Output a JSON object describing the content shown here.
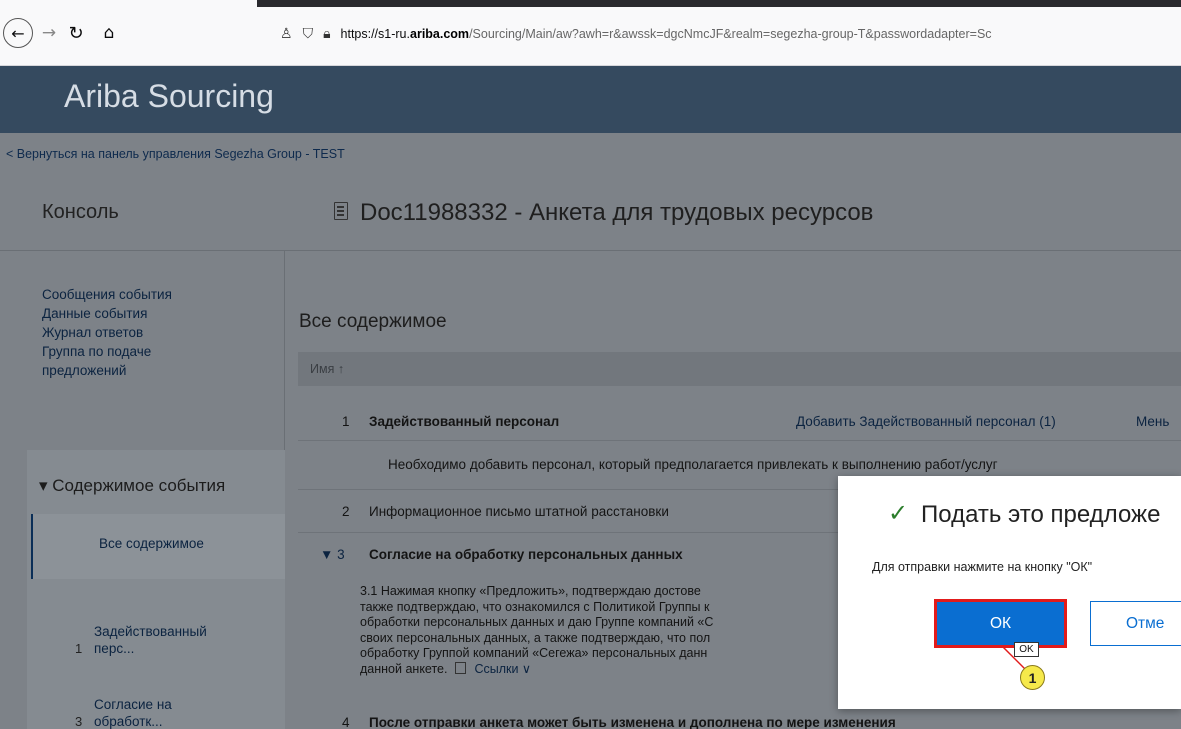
{
  "browser": {
    "url_prefix": "https://s1-ru.",
    "url_domain": "ariba.com",
    "url_rest": "/Sourcing/Main/aw?awh=r&awssk=dgcNmcJF&realm=segezha-group-T&passwordadapter=Sc",
    "back_icon": "back-arrow-icon",
    "forward_icon": "forward-arrow-icon",
    "reload_icon": "reload-icon",
    "home_icon": "home-icon"
  },
  "app": {
    "title": "Ariba Sourcing"
  },
  "back_link": "< Вернуться на панель управления Segezha Group - TEST",
  "left_title": "Консоль",
  "doc_title": "Doc11988332 - Анкета для трудовых ресурсов",
  "sidebar": {
    "links": [
      "Сообщения события",
      "Данные события",
      "Журнал ответов",
      "Группа по подаче",
      "предложений"
    ],
    "group_head": "▾ Содержимое события",
    "selected": "Все содержимое",
    "items": [
      {
        "num": "1",
        "line1": "Задействованный",
        "line2": "перс..."
      },
      {
        "num": "3",
        "line1": "Согласие на",
        "line2": "обработк..."
      }
    ]
  },
  "main": {
    "section_title": "Все содержимое",
    "column_header": "Имя ↑",
    "rows": {
      "r1_num": "1",
      "r1_title": "Задействованный персонал",
      "r1_link": "Добавить Задействованный персонал (1)",
      "r1_link2": "Мень",
      "r1_desc": "Необходимо добавить персонал, который предполагается привлекать к выполнению работ/услуг",
      "r2_num": "2",
      "r2_title": "Информационное письмо штатной расстановки",
      "r3_num": "▼ 3",
      "r3_title": "Согласие на обработку персональных данных",
      "r3_para_l1": "3.1  Нажимая кнопку «Предложить», подтверждаю достове",
      "r3_para_l2": "также подтверждаю, что ознакомился с Политикой Группы к",
      "r3_para_l3": "обработки персональных данных и даю Группе компаний «С",
      "r3_para_l4": "своих персональных данных, а также подтверждаю, что пол",
      "r3_para_l5": "обработку Группой компаний «Сегежа» персональных данн",
      "r3_para_l6": "данной анкете.",
      "r3_links": "Ссылки ∨",
      "r4_num": "4",
      "r4_title": "После отправки анкета может быть изменена и дополнена по мере изменения"
    }
  },
  "dialog": {
    "check_icon": "checkmark-icon",
    "title": "Подать это предложе",
    "message": "Для отправки нажмите на кнопку \"ОК\"",
    "ok_label": "ОК",
    "cancel_label": "Отме",
    "tooltip": "OK",
    "step_badge": "1"
  },
  "colors": {
    "header": "#354a5f",
    "overlay": "#7d8288",
    "primary": "#0a6ed1",
    "highlight": "#e21b1b",
    "badge": "#f6e94b"
  }
}
